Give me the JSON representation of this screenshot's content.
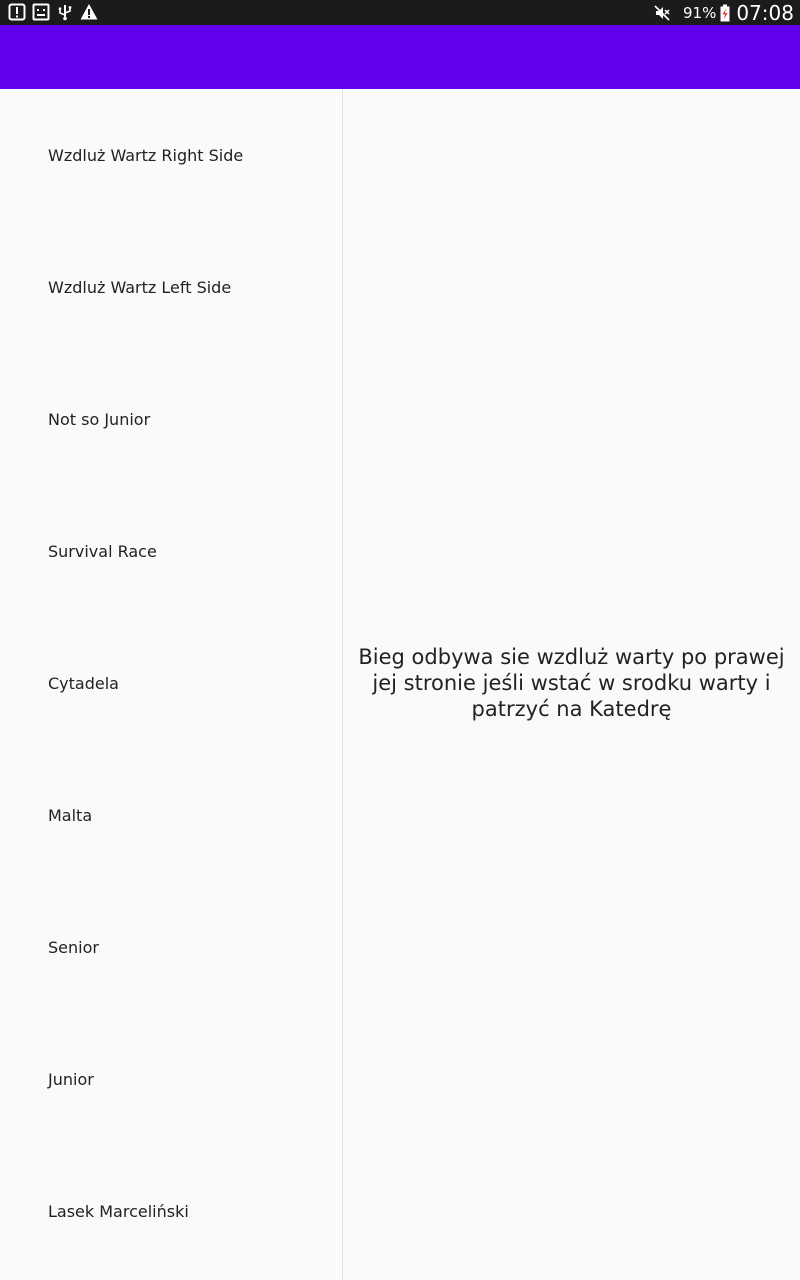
{
  "status_bar": {
    "left_icons": [
      "alert-box-icon",
      "screenshot-icon",
      "usb-icon",
      "warning-icon"
    ],
    "battery_percent": "91%",
    "time": "07:08"
  },
  "colors": {
    "app_bar": "#6200ee",
    "status_bar": "#1b1b1b",
    "background": "#fafafa"
  },
  "list": {
    "items": [
      "Wzdluż Wartz Right Side",
      "Wzdluż Wartz Left Side",
      "Not so Junior",
      "Survival Race",
      "Cytadela",
      "Malta",
      "Senior",
      "Junior",
      "Lasek Marceliński"
    ]
  },
  "detail": {
    "description": "Bieg odbywa sie wzdluż warty po prawej jej stronie jeśli wstać w srodku warty i patrzyć na Katedrę"
  }
}
